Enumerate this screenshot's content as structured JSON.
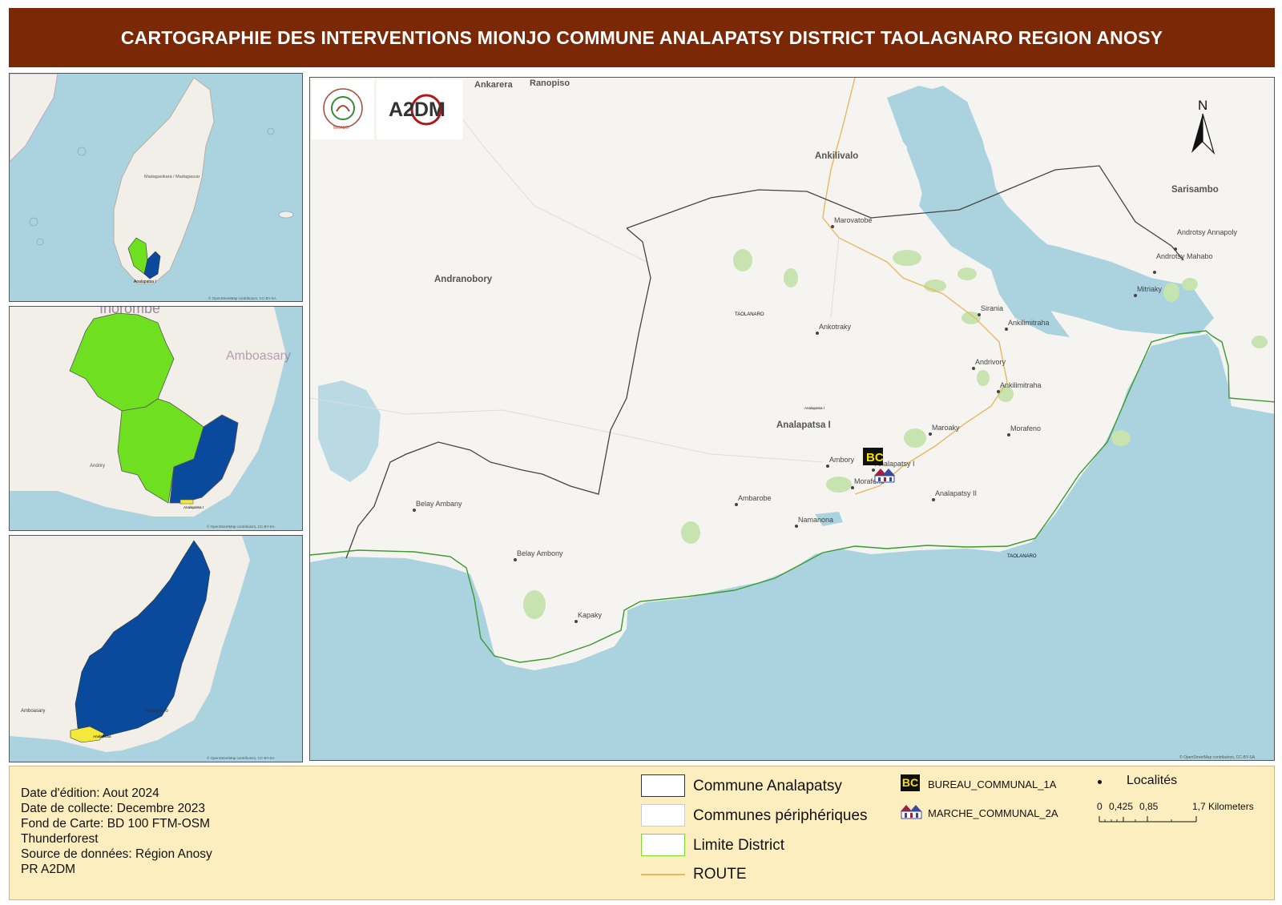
{
  "title": "CARTOGRAPHIE DES INTERVENTIONS MIONJO COMMUNE ANALAPATSY DISTRICT TAOLAGNARO REGION ANOSY",
  "logos": {
    "mionjo": "MIONJO",
    "a2dm": "A2DM"
  },
  "north_arrow": "N",
  "inset_1": {
    "labels": {
      "madagascar": "Madagasikara / Madagascar",
      "selected": "Analapatsa I"
    },
    "attribution": "© OpenStreetMap contributors, CC-BY-SA"
  },
  "inset_2": {
    "labels": {
      "city": "Ihorombe",
      "area": "Amboasary",
      "place": "Andriry",
      "sel": "Analapatsa I"
    },
    "attribution": "© OpenStreetMap contributors, CC-BY-SA"
  },
  "inset_3": {
    "labels": {
      "town": "Amboasary",
      "city": "Taolagnaro",
      "sel": "Analapatsa"
    },
    "attribution": "© OpenStreetMap contributors, CC-BY-SA"
  },
  "main_map": {
    "regions": {
      "andranobory": "Andranobory",
      "analapatsa": "Analapatsa I",
      "ankilivalo": "Ankilivalo",
      "sarisambo": "Sarisambo",
      "ankarera": "Ankarera",
      "ranopiso": "Ranopiso",
      "taolanaro_a": "TAOLANARO",
      "taolanaro_b": "TAOLANARO",
      "analapatsa_small": "Analapatsa I"
    },
    "localities": [
      "Marovatobe",
      "Ankotraky",
      "Sirania",
      "Ankilimitraha",
      "Andrivory",
      "Ankilimitraha",
      "Maroaky",
      "Morafeno",
      "Ambory",
      "Analapatsy I",
      "Morafeno",
      "Ambarobe",
      "Namanona",
      "Analapatsy II",
      "Belay Ambany",
      "Belay Ambony",
      "Kapaky",
      "Androtsy Annapoly",
      "Androtsy Mahabo",
      "Mitriaky"
    ],
    "attribution": "© OpenStreetMap contributors, CC-BY-SA"
  },
  "meta": {
    "edition": "Date d'édition: Aout 2024",
    "collecte": "Date de collecte: Decembre 2023",
    "fond": "Fond de Carte: BD 100 FTM-OSM",
    "thunderforest": "Thunderforest",
    "source": "Source de données: Région Anosy",
    "pr": "PR A2DM"
  },
  "legend": {
    "commune": "Commune Analapatsy",
    "peripheriques": "Communes périphériques",
    "district": "Limite District",
    "route": "ROUTE",
    "bureau": "BUREAU_COMMUNAL_1A",
    "bureau_icon": "BC",
    "marche": "MARCHE_COMMUNAL_2A",
    "localites": "Localités",
    "scale_ticks": [
      "0",
      "0,425",
      "0,85",
      "1,7 Kilometers"
    ]
  },
  "colors": {
    "title_bg": "#7a2806",
    "sea": "#aad3df",
    "land": "#f5f4f0",
    "district_line": "#3a9a2a",
    "route": "#e8b860",
    "green_fill": "#6fe020",
    "blue_fill": "#0a4a9c",
    "legend_bg": "#fdeec0"
  }
}
